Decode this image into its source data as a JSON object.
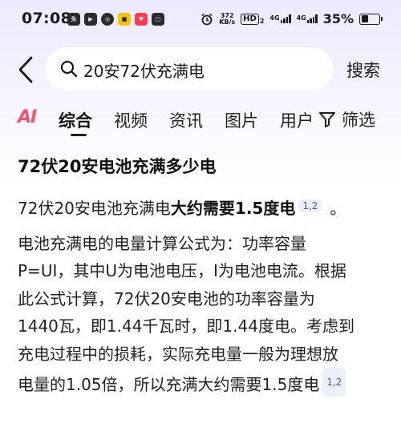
{
  "status_bar": {
    "time": "07:08",
    "app_icons": [
      "toutiao-icon",
      "video-icon",
      "circle-app-icon",
      "yellow-app-icon",
      "red-app-icon",
      "notification-icon"
    ],
    "net_speed_value": "372",
    "net_speed_unit": "KB/s",
    "hd_label": "HD",
    "hd_sub": "2",
    "signal1_label": "4G",
    "signal2_label": "4G",
    "battery_percent": "35%"
  },
  "search": {
    "query": "20安72伏充满电",
    "submit_label": "搜索"
  },
  "tabs": {
    "ai_label": "AI",
    "items": [
      "综合",
      "视频",
      "资讯",
      "图片",
      "用户"
    ],
    "active_index": 0,
    "filter_label": "筛选"
  },
  "result": {
    "title": "72伏20安电池充满多少电",
    "answer_prefix": "72伏20安电池充满电",
    "answer_bold": "大约需要1.5度电",
    "answer_cite": "1,2",
    "answer_suffix": "。",
    "lines": [
      "电池充满电的电量计算公式为：功率容量",
      "P=UI，其中U为电池电压，I为电池电流。根据",
      "此公式计算，72伏20安电池的功率容量为",
      "1440瓦，即1.44千瓦时，即1.44度电。考虑到",
      "充电过程中的损耗，实际充电量一般为理想放"
    ],
    "last_line": "电量的1.05倍，所以充满大约需要1.5度电",
    "last_cite": "1,2"
  },
  "colors": {
    "ai_accent": "#ff4d6d",
    "citation_bg": "#eceff8",
    "citation_text": "#4a5a9a"
  }
}
